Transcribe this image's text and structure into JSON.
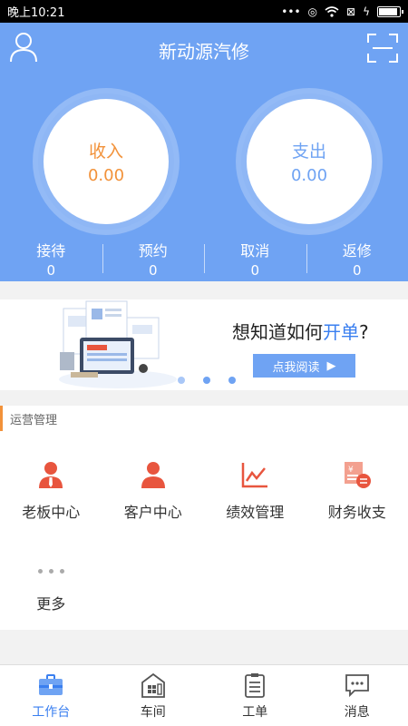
{
  "status_bar": {
    "time": "晚上10:21"
  },
  "header": {
    "title": "新动源汽修",
    "income": {
      "label": "收入",
      "value": "0.00"
    },
    "expense": {
      "label": "支出",
      "value": "0.00"
    },
    "stats": [
      {
        "label": "接待",
        "value": "0"
      },
      {
        "label": "预约",
        "value": "0"
      },
      {
        "label": "取消",
        "value": "0"
      },
      {
        "label": "返修",
        "value": "0"
      }
    ]
  },
  "banner": {
    "headline_pre": "想知道如何",
    "headline_hl": "开单",
    "headline_post": "?",
    "button": "点我阅读",
    "slides_count": 3,
    "active_slide": 1
  },
  "ops": {
    "title": "运营管理",
    "items": [
      {
        "label": "老板中心",
        "icon": "boss-icon"
      },
      {
        "label": "客户中心",
        "icon": "customer-icon"
      },
      {
        "label": "绩效管理",
        "icon": "performance-chart-icon"
      },
      {
        "label": "财务收支",
        "icon": "finance-icon"
      }
    ],
    "more": "更多"
  },
  "tabs": [
    {
      "label": "工作台",
      "icon": "workbench-icon",
      "active": true
    },
    {
      "label": "车间",
      "icon": "workshop-icon",
      "active": false
    },
    {
      "label": "工单",
      "icon": "work-order-icon",
      "active": false
    },
    {
      "label": "消息",
      "icon": "message-icon",
      "active": false
    }
  ],
  "colors": {
    "primary": "#6fa3f3",
    "accent": "#f2923a",
    "highlight": "#3a7ff0",
    "icon_red": "#e8553e"
  }
}
